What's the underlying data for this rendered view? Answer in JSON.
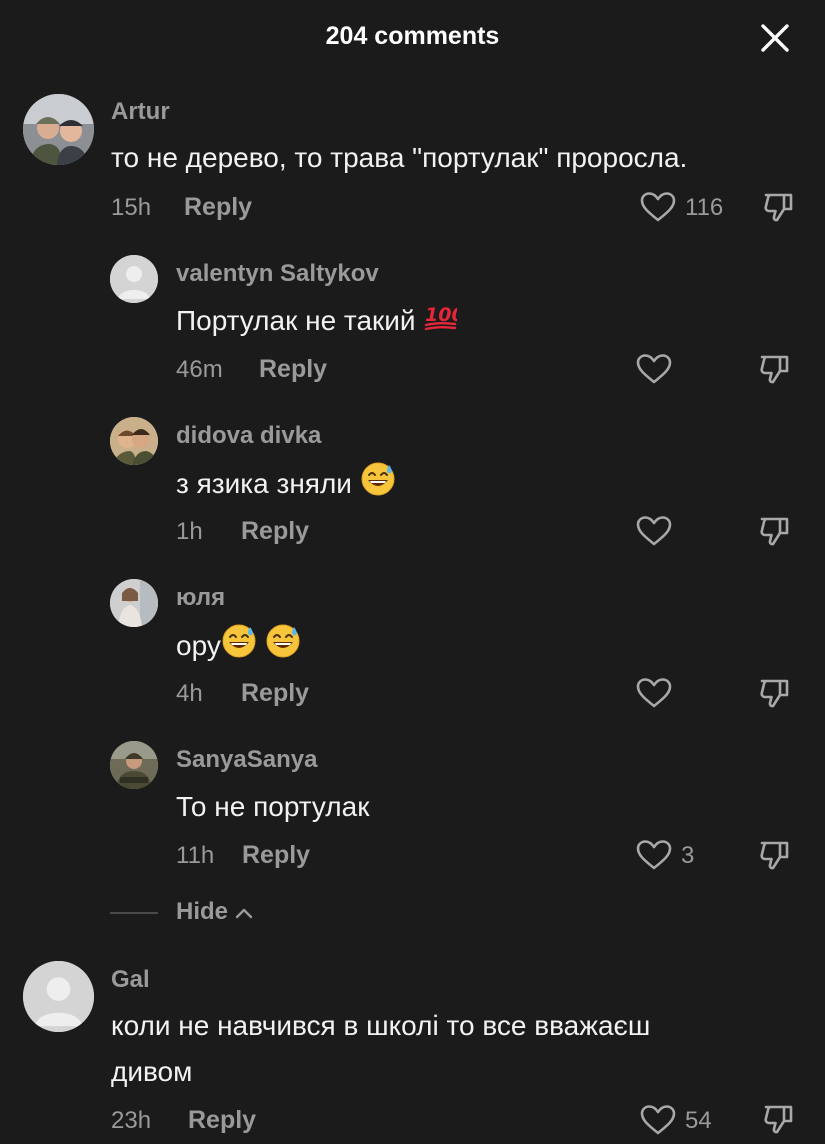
{
  "header": {
    "title": "204 comments",
    "close_icon": "close-icon"
  },
  "colors": {
    "background": "#1b1b1b",
    "secondary_text": "#9a9a9a",
    "primary_text": "#f2f2f2"
  },
  "comments": [
    {
      "username": "Artur",
      "text": "то не дерево, то трава \"портулак\" проросла.",
      "time": "15h",
      "reply_label": "Reply",
      "likes": "116",
      "replies": [
        {
          "username": "valentyn Saltykov",
          "text": "Портулак не такий",
          "emoji": "hundred-points-emoji",
          "time": "46m",
          "reply_label": "Reply",
          "likes": ""
        },
        {
          "username": "didova divka",
          "text": "з язика зняли",
          "emoji": "grinning-sweat-emoji",
          "time": "1h",
          "reply_label": "Reply",
          "likes": ""
        },
        {
          "username": "юля",
          "text": "ору",
          "emoji": "grinning-sweat-emoji x2",
          "time": "4h",
          "reply_label": "Reply",
          "likes": ""
        },
        {
          "username": "SanyaSanya",
          "text": "То не портулак",
          "time": "11h",
          "reply_label": "Reply",
          "likes": "3"
        }
      ],
      "hide_label": "Hide"
    },
    {
      "username": "Gal",
      "text_line1": "коли не навчився в школі то все вважаєш",
      "text_line2": "дивом",
      "time": "23h",
      "reply_label": "Reply",
      "likes": "54"
    }
  ]
}
